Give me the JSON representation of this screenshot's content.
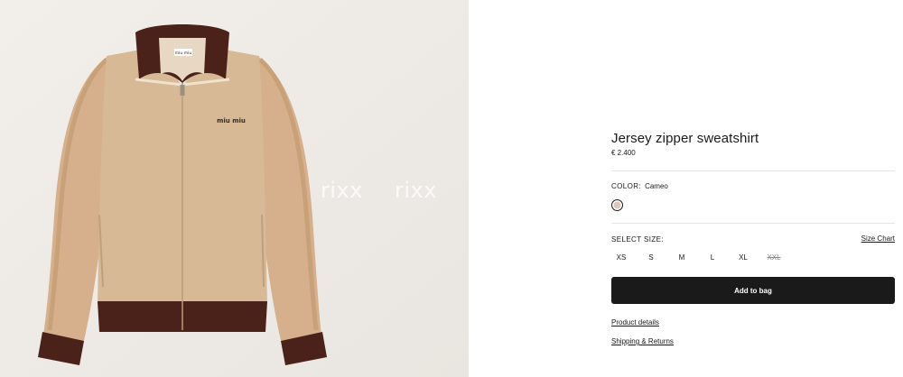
{
  "product_image": {
    "watermark": [
      "rixx",
      "rixx"
    ],
    "logo_text": "miu miu",
    "jacket_color": "#d8b995",
    "trim_color": "#4a2219"
  },
  "product": {
    "title": "Jersey zipper sweatshirt",
    "price": "€ 2.400",
    "color_label": "COLOR:",
    "color_value": "Cameo",
    "swatch_color": "#dcc8bc"
  },
  "size_selector": {
    "label": "SELECT SIZE:",
    "size_chart": "Size Chart",
    "sizes": [
      {
        "label": "XS",
        "available": true
      },
      {
        "label": "S",
        "available": true
      },
      {
        "label": "M",
        "available": true
      },
      {
        "label": "L",
        "available": true
      },
      {
        "label": "XL",
        "available": true
      },
      {
        "label": "XXL",
        "available": false
      }
    ]
  },
  "actions": {
    "add_to_bag": "Add to bag",
    "product_details": "Product details",
    "shipping_returns": "Shipping & Returns"
  }
}
